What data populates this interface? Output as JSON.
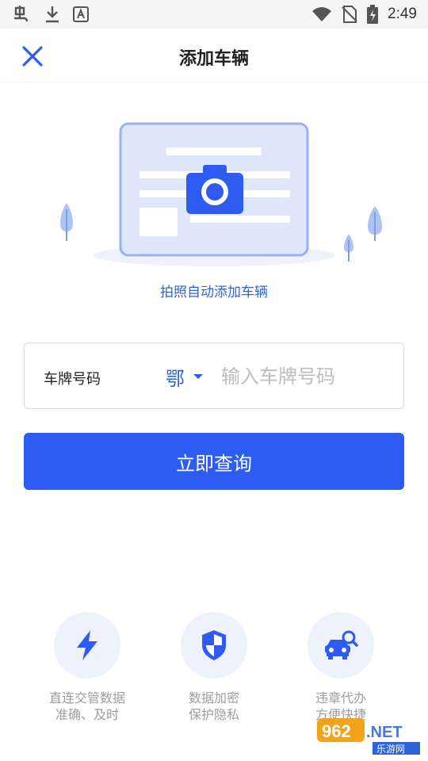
{
  "status_bar": {
    "time": "2:49",
    "left_icons": [
      "app-notification-icon",
      "download-icon",
      "font-app-icon"
    ],
    "right_icons": [
      "wifi-icon",
      "no-sim-icon",
      "battery-icon"
    ]
  },
  "header": {
    "title": "添加车辆",
    "close_icon": "close-icon"
  },
  "illustration": {
    "icon": "camera-card-icon",
    "link_text": "拍照自动添加车辆"
  },
  "plate_form": {
    "label": "车牌号码",
    "province": "鄂",
    "placeholder": "输入车牌号码",
    "value": ""
  },
  "submit_button": {
    "label": "立即查询"
  },
  "features": [
    {
      "icon": "lightning-icon",
      "line1": "直连交管数据",
      "line2": "准确、及时"
    },
    {
      "icon": "shield-icon",
      "line1": "数据加密",
      "line2": "保护隐私"
    },
    {
      "icon": "car-search-icon",
      "line1": "违章代办",
      "line2": "方便快捷"
    }
  ],
  "watermark": {
    "brand": "962.NET",
    "subtitle": "乐游网"
  },
  "colors": {
    "accent": "#2e5cf2",
    "link": "#2f63d9",
    "feature_bg": "#eef2fc",
    "muted_text": "#9e9e9e"
  }
}
